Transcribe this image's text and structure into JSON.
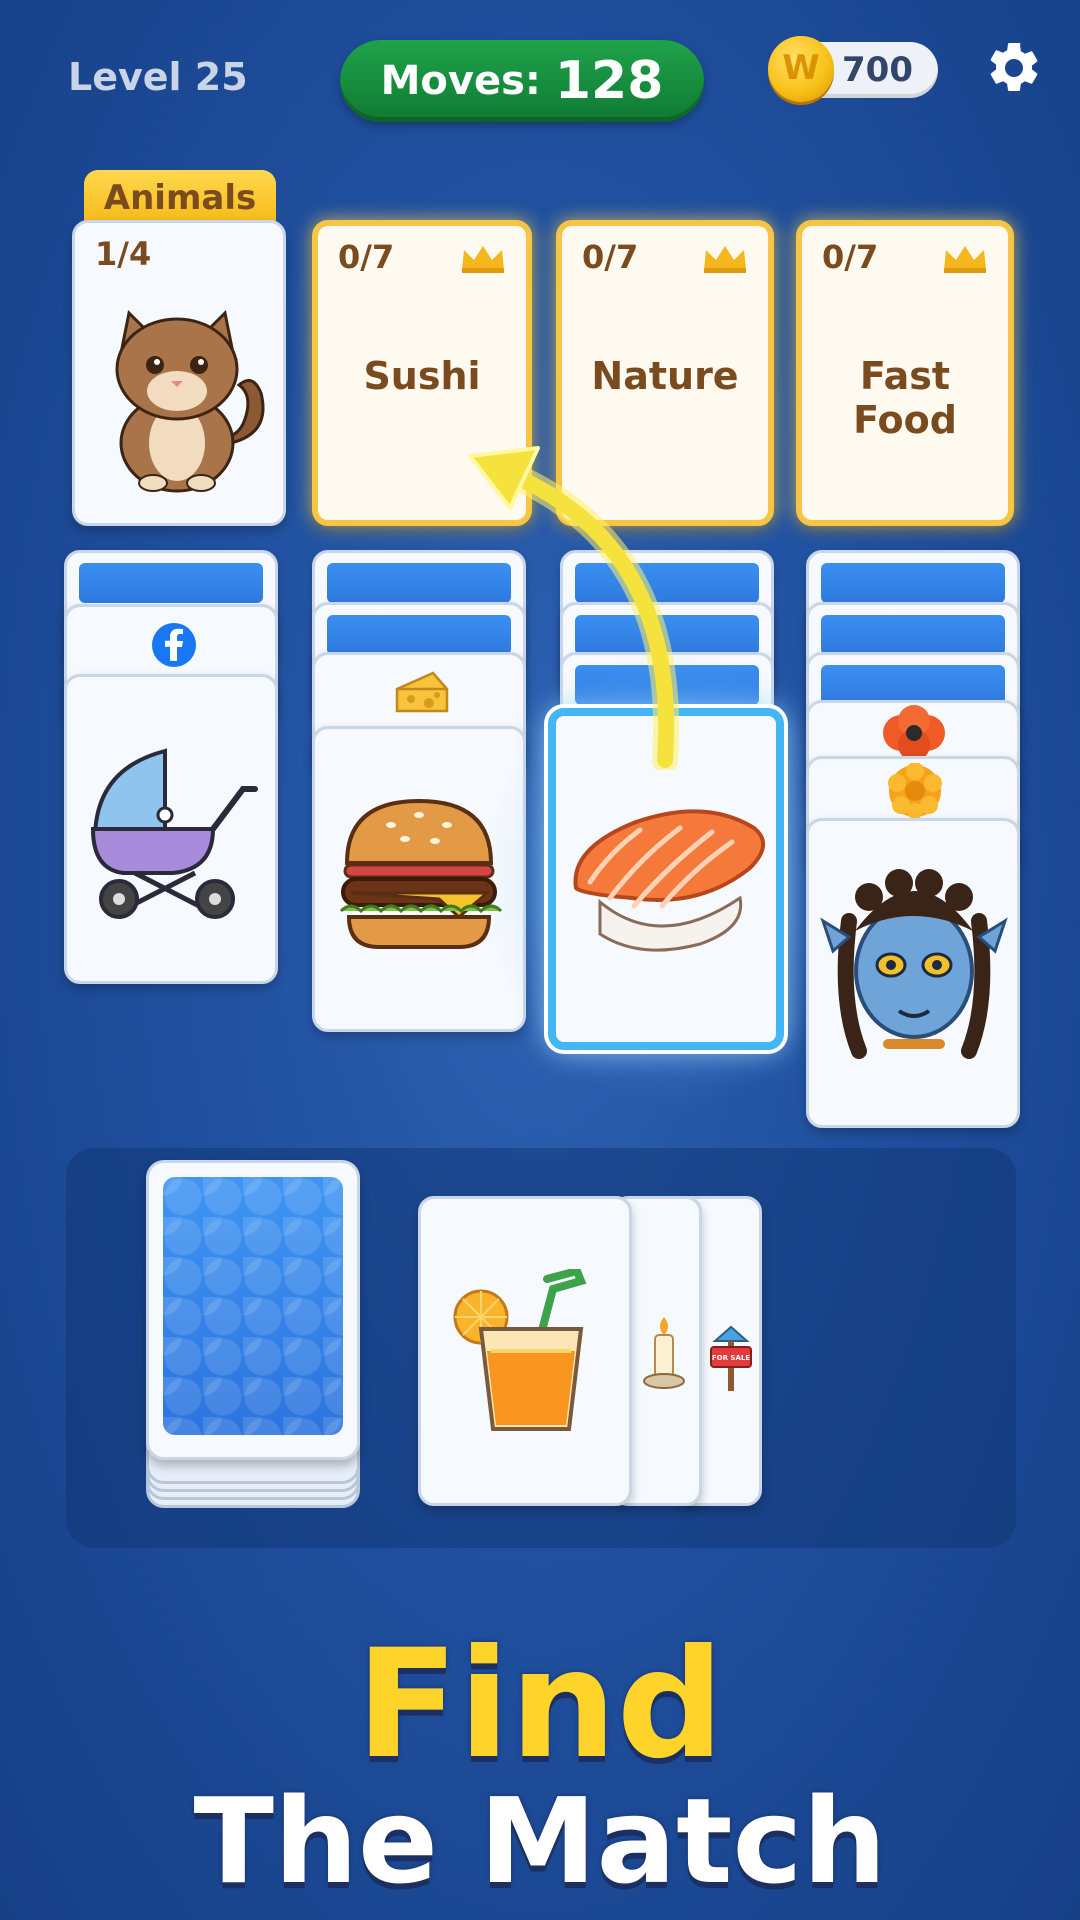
{
  "header": {
    "level": "Level 25",
    "moves_label": "Moves:",
    "moves_value": "128",
    "coins": "700"
  },
  "category_slots": [
    {
      "tab": "Animals",
      "count": "1/4",
      "image": "cat-icon"
    },
    {
      "count": "0/7",
      "title": "Sushi",
      "highlighted": true
    },
    {
      "count": "0/7",
      "title": "Nature"
    },
    {
      "count": "0/7",
      "title": "Fast Food"
    }
  ],
  "tableau": [
    {
      "column": 1,
      "visible": [
        "facebook-icon",
        "stroller-icon"
      ]
    },
    {
      "column": 2,
      "visible": [
        "cheese-icon",
        "burger-icon"
      ]
    },
    {
      "column": 3,
      "visible": [
        "sushi-icon"
      ],
      "selected": "sushi-icon"
    },
    {
      "column": 4,
      "visible": [
        "poppy-icon",
        "marigold-icon",
        "avatar-face-icon"
      ]
    }
  ],
  "waste": [
    "juice-icon",
    "candle-icon",
    "for-sale-sign-icon"
  ],
  "for_sale_sign_text": "FOR SALE",
  "headline": {
    "line1": "Find",
    "line2": "The Match"
  },
  "colors": {
    "background": "#20509f",
    "moves_pill": "#1fa34a",
    "gold_border": "#f6c546",
    "selected_border": "#43b6f5",
    "headline_yellow": "#ffd42a"
  }
}
